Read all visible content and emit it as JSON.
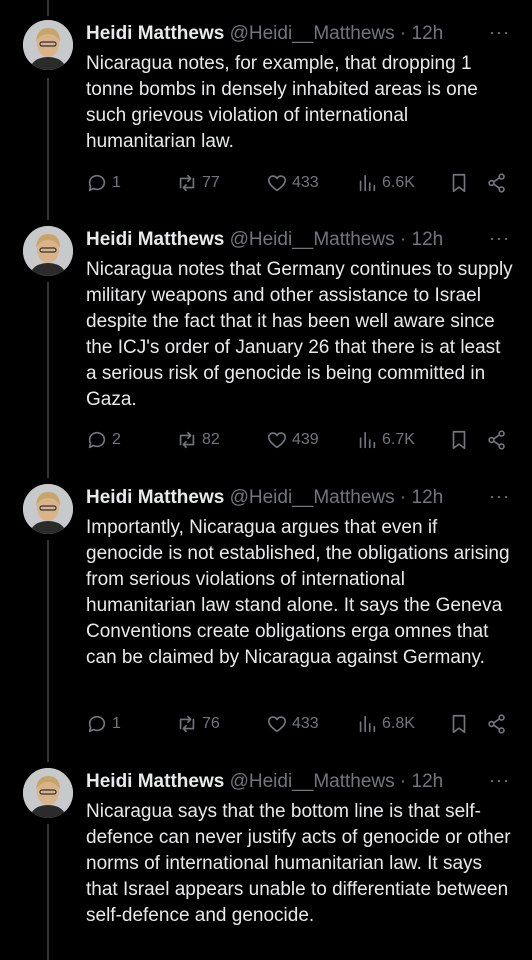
{
  "tweets": [
    {
      "name": "Heidi Matthews",
      "handle": "@Heidi__Matthews",
      "time": "· 12h",
      "more": "···",
      "text": "Nicaragua notes, for example, that dropping 1 tonne bombs in densely inhabited areas is one such grievous violation of international humanitarian law.",
      "replies": "1",
      "retweets": "77",
      "likes": "433",
      "views": "6.6K"
    },
    {
      "name": "Heidi Matthews",
      "handle": "@Heidi__Matthews",
      "time": "· 12h",
      "more": "···",
      "text": "Nicaragua notes that Germany continues to supply military weapons and other assistance to Israel despite the fact that it has been well aware since the ICJ's order of January 26 that there is at least a serious risk of genocide is being committed in Gaza.",
      "replies": "2",
      "retweets": "82",
      "likes": "439",
      "views": "6.7K"
    },
    {
      "name": "Heidi Matthews",
      "handle": "@Heidi__Matthews",
      "time": "· 12h",
      "more": "···",
      "text": "Importantly, Nicaragua argues that even if genocide is not established, the obligations arising from serious violations of international humanitarian law stand alone. It says the Geneva Conventions create obligations erga omnes that can be claimed by Nicaragua against Germany.",
      "replies": "1",
      "retweets": "76",
      "likes": "433",
      "views": "6.8K"
    },
    {
      "name": "Heidi Matthews",
      "handle": "@Heidi__Matthews",
      "time": "· 12h",
      "more": "···",
      "text": "Nicaragua says that the bottom line is that self-defence can never justify acts of genocide or other norms of international humanitarian law. It says that Israel appears unable to differentiate between self-defence and genocide."
    }
  ]
}
